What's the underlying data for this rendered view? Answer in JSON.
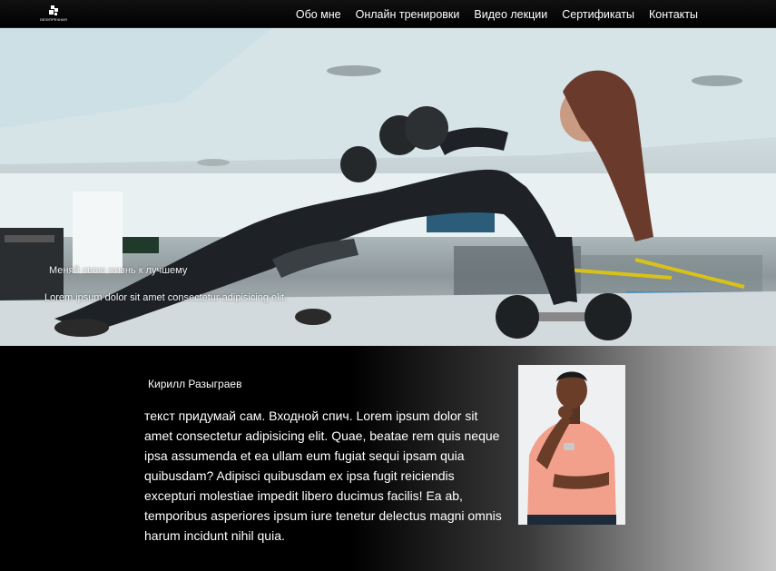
{
  "header": {
    "logo_text": "БЕЗУПРЕЧНАЯ",
    "nav": [
      "Обо мне",
      "Онлайн тренировки",
      "Видео лекции",
      "Сертификаты",
      "Контакты"
    ]
  },
  "hero": {
    "title": "Меняй свою жизнь к лучшему",
    "subtitle": "Lorem ipsum dolor sit amet consectetur adipisicing elit."
  },
  "about": {
    "name": "Кирилл Разыграев",
    "text": "текст придумай сам. Входной спич. Lorem ipsum dolor sit amet consectetur adipisicing elit. Quae, beatae rem quis neque ipsa assumenda et ea ullam eum fugiat sequi ipsam quia quibusdam? Adipisci quibusdam ex ipsa fugit reiciendis excepturi molestiae impedit libero ducimus facilis! Ea ab, temporibus asperiores ipsum iure tenetur delectus magni omnis harum incidunt nihil quia."
  },
  "colors": {
    "header_bg": "#000000",
    "nav_text": "#ffffff",
    "about_bg_start": "#000000",
    "about_bg_end": "#c8c8c8"
  }
}
